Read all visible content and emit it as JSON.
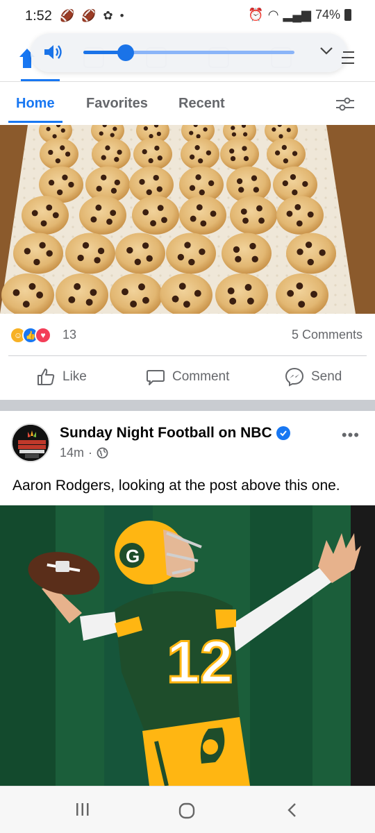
{
  "status_bar": {
    "time": "1:52",
    "battery": "74%",
    "left_icons": [
      "football-icon",
      "football-icon",
      "plant-icon",
      "dot-icon"
    ],
    "right_icons": [
      "alarm-icon",
      "wifi-icon",
      "signal-icon",
      "battery-icon"
    ]
  },
  "volume": {
    "level": 0.2
  },
  "tabs": [
    {
      "label": "Home",
      "active": true
    },
    {
      "label": "Favorites",
      "active": false
    },
    {
      "label": "Recent",
      "active": false
    }
  ],
  "post1": {
    "image": "cookies-photo",
    "reaction_count": "13",
    "comments": "5 Comments",
    "reactions": [
      "care",
      "like",
      "love"
    ],
    "actions": {
      "like": "Like",
      "comment": "Comment",
      "send": "Send"
    }
  },
  "post2": {
    "page_name": "Sunday Night Football on NBC",
    "time": "14m",
    "visibility": "globe-icon",
    "text": "Aaron Rodgers, looking at the post above this one.",
    "image": "football-player-photo"
  },
  "colors": {
    "accent": "#1877f2",
    "secondary_text": "#65676b",
    "packers_green": "#1e4d2b",
    "packers_gold": "#ffb612"
  }
}
